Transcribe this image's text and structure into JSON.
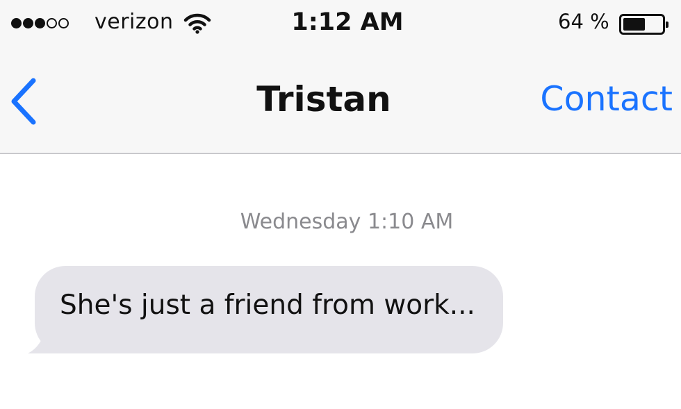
{
  "status_bar": {
    "signal": {
      "filled": 3,
      "total": 5
    },
    "carrier": "verizon",
    "wifi_icon": "wifi-icon",
    "time": "1:12 AM",
    "battery_percent": "64 %",
    "battery_level": 0.64
  },
  "nav": {
    "back_icon": "chevron-left-icon",
    "title": "Tristan",
    "contact_label": "Contact"
  },
  "conversation": {
    "timestamp": "Wednesday 1:10 AM",
    "messages": [
      {
        "direction": "incoming",
        "text": "She's just a friend from work..."
      }
    ]
  },
  "colors": {
    "accent": "#1a73ff",
    "incoming_bubble": "#e5e4ea",
    "header_background": "#f7f7f7",
    "timestamp_text": "#8a8a8e"
  }
}
